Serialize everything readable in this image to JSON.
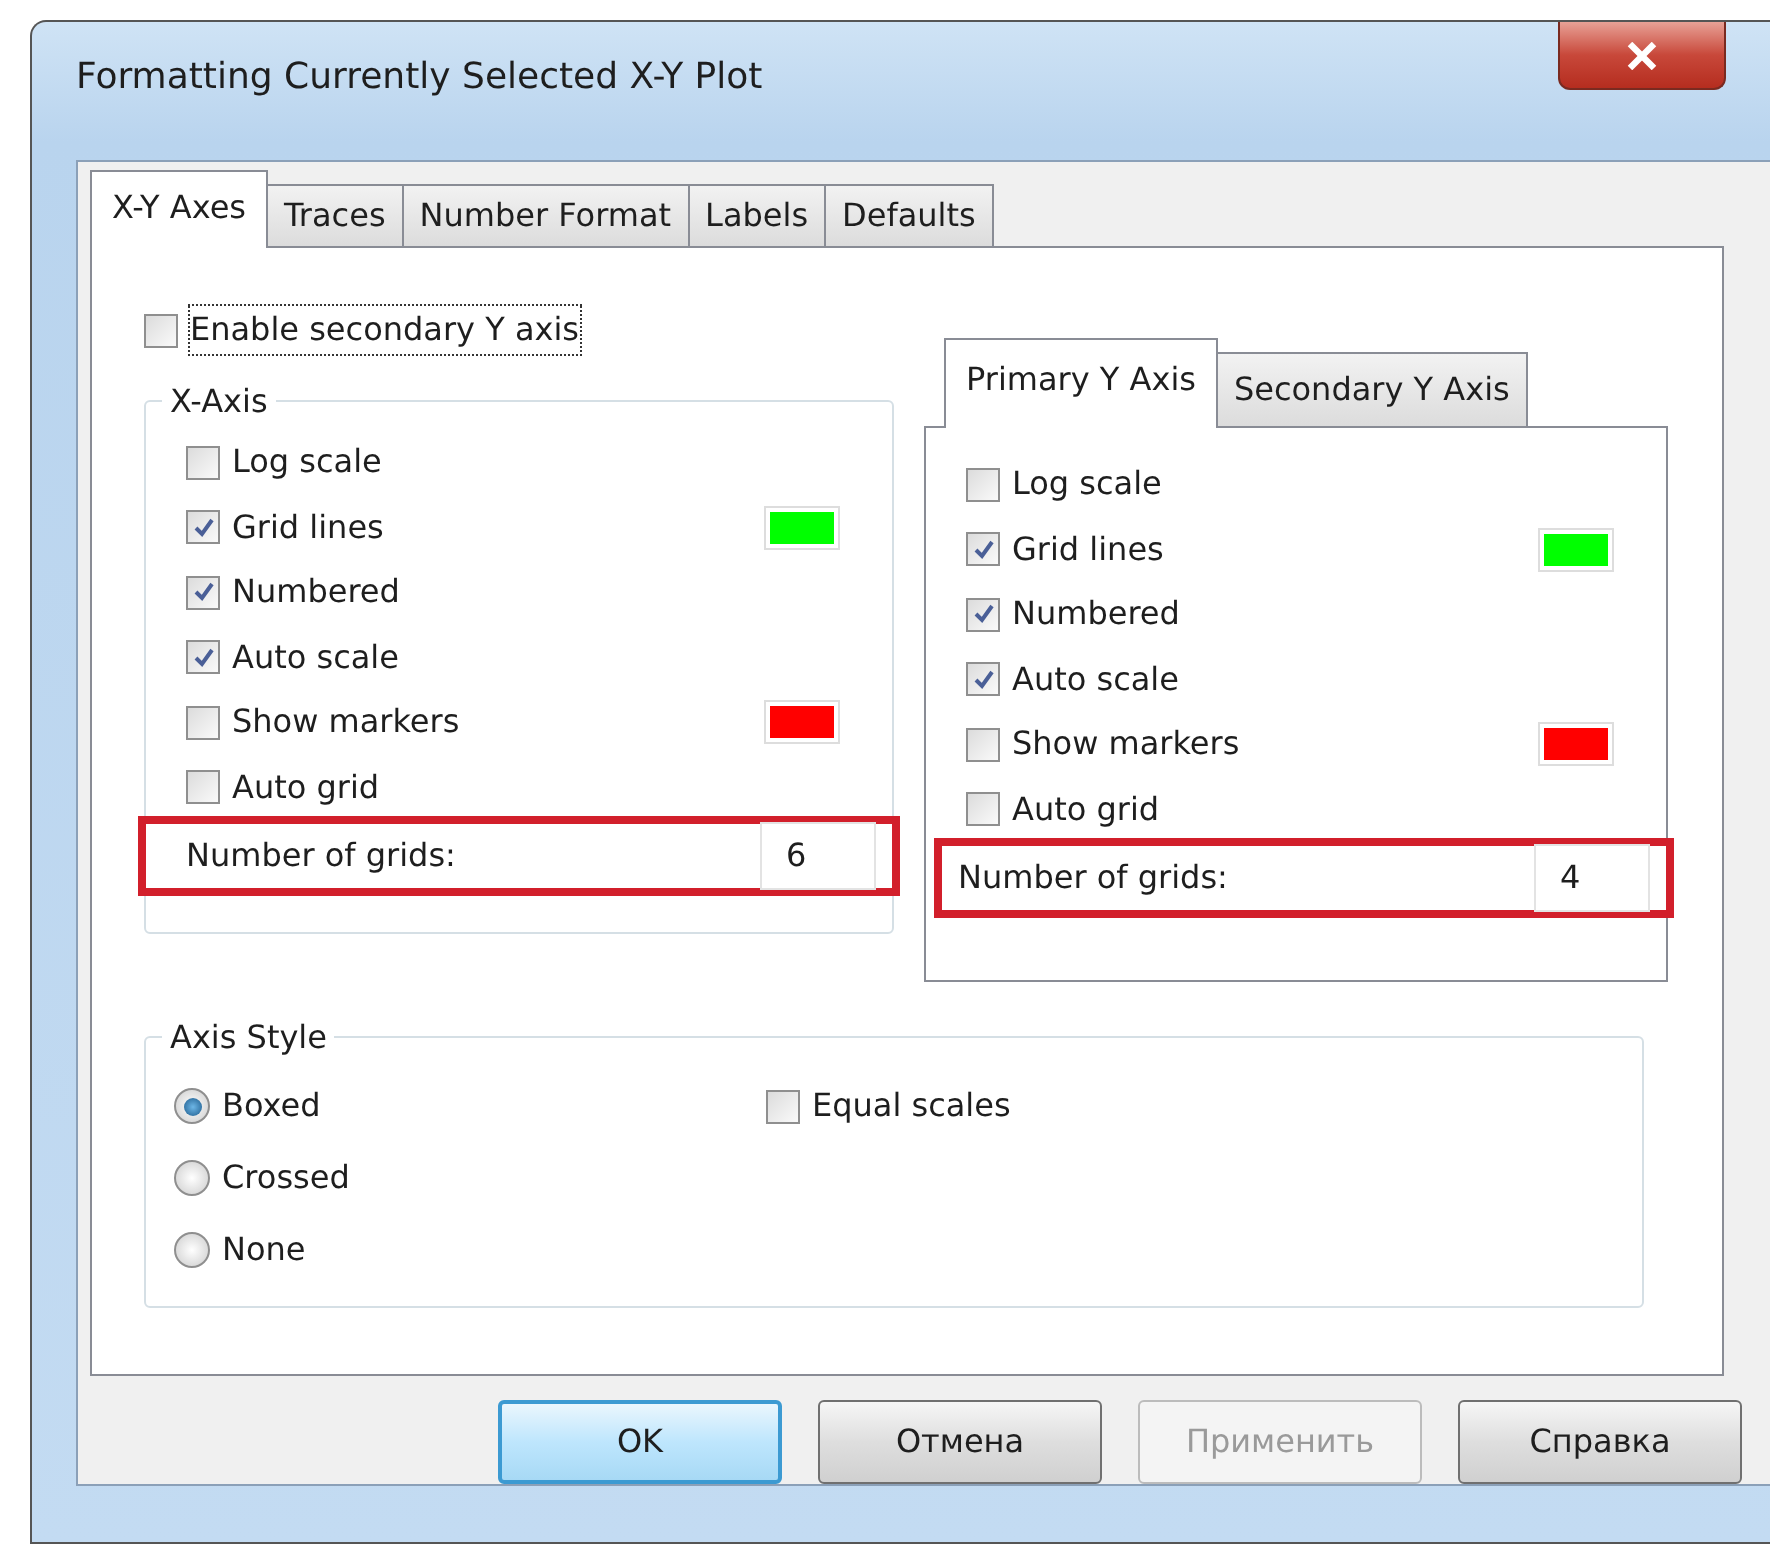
{
  "window": {
    "title": "Formatting Currently Selected X-Y Plot"
  },
  "tabs": [
    {
      "label": "X-Y Axes",
      "selected": true
    },
    {
      "label": "Traces",
      "selected": false
    },
    {
      "label": "Number Format",
      "selected": false
    },
    {
      "label": "Labels",
      "selected": false
    },
    {
      "label": "Defaults",
      "selected": false
    }
  ],
  "enable_secondary_y_axis": {
    "label": "Enable secondary Y axis",
    "checked": false,
    "focused": true
  },
  "x_axis": {
    "title": "X-Axis",
    "options": [
      {
        "label": "Log scale",
        "checked": false
      },
      {
        "label": "Grid lines",
        "checked": true,
        "color": "#00ff00"
      },
      {
        "label": "Numbered",
        "checked": true
      },
      {
        "label": "Auto scale",
        "checked": true
      },
      {
        "label": "Show markers",
        "checked": false,
        "color": "#ff0000"
      },
      {
        "label": "Auto grid",
        "checked": false
      }
    ],
    "number_of_grids": {
      "label": "Number of grids:",
      "value": "6",
      "highlighted": true
    }
  },
  "y_axis": {
    "tabs": [
      {
        "label": "Primary Y Axis",
        "selected": true
      },
      {
        "label": "Secondary Y Axis",
        "selected": false
      }
    ],
    "options": [
      {
        "label": "Log scale",
        "checked": false
      },
      {
        "label": "Grid lines",
        "checked": true,
        "color": "#00ff00"
      },
      {
        "label": "Numbered",
        "checked": true
      },
      {
        "label": "Auto scale",
        "checked": true
      },
      {
        "label": "Show markers",
        "checked": false,
        "color": "#ff0000"
      },
      {
        "label": "Auto grid",
        "checked": false
      }
    ],
    "number_of_grids": {
      "label": "Number of grids:",
      "value": "4",
      "highlighted": true
    }
  },
  "axis_style": {
    "title": "Axis Style",
    "radios": [
      {
        "label": "Boxed",
        "selected": true
      },
      {
        "label": "Crossed",
        "selected": false
      },
      {
        "label": "None",
        "selected": false
      }
    ],
    "equal_scales": {
      "label": "Equal scales",
      "checked": false
    }
  },
  "buttons": [
    {
      "label": "OK",
      "default": true,
      "disabled": false
    },
    {
      "label": "Отмена",
      "default": false,
      "disabled": false
    },
    {
      "label": "Применить",
      "default": false,
      "disabled": true
    },
    {
      "label": "Справка",
      "default": false,
      "disabled": false
    }
  ]
}
